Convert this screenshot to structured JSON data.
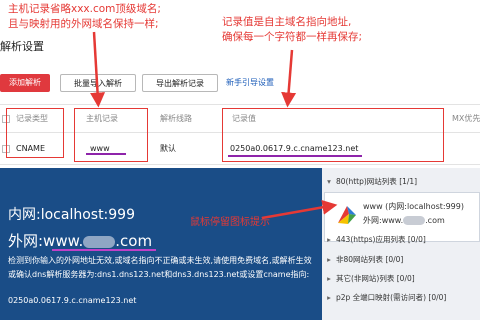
{
  "page": {
    "title": "解析设置"
  },
  "toolbar": {
    "add_label": "添加解析",
    "import_label": "批量导入解析",
    "export_label": "导出解析记录",
    "guide_label": "新手引导设置"
  },
  "table": {
    "headers": {
      "record_type": "记录类型",
      "host_record": "主机记录",
      "line": "解析线路",
      "record_value": "记录值",
      "mx": "MX优先"
    },
    "row": {
      "record_type": "CNAME",
      "host_record": "www",
      "line": "默认",
      "record_value": "0250a0.0617.9.c.cname123.net"
    }
  },
  "annotations": {
    "note_host_1": "主机记录省略xxx.com顶级域名;",
    "note_host_2": "且与映射用的外网域名保持一样;",
    "note_value_1": "记录值是自主域名指向地址,",
    "note_value_2": "确保每一个字符都一样再保存;",
    "hover_hint": "鼠标停留图标提示"
  },
  "overlay": {
    "inner": "内网:localhost:999",
    "outer_prefix": "外网:www.",
    "outer_suffix": ".com",
    "desc": "检测到你输入的外网地址无效,或域名指向不正确或未生效,请使用免费域名,或解析生效或确认dns解析服务器为:dns1.dns123.net和dns3.dns123.net或设置cname指向:",
    "cname": "0250a0.0617.9.c.cname123.net"
  },
  "sidebar": {
    "items": [
      {
        "label": "80(http)网站列表",
        "count": "[1/1]"
      },
      {
        "label": "443(https)应用列表",
        "count": "[0/0]"
      },
      {
        "label": "非80网站列表",
        "count": "[0/0]"
      },
      {
        "label": "其它(非网站)列表",
        "count": "[0/0]"
      },
      {
        "label": "p2p 全端口映射(需访问者)",
        "count": "[0/0]"
      }
    ],
    "card": {
      "line1": "www (内网:localhost:999)",
      "line2_prefix": "外网:www.",
      "line2_suffix": ".com"
    }
  },
  "colors": {
    "accent_red": "#e53935",
    "overlay_blue": "#1a4d87",
    "underline_purple": "#8e24aa",
    "link_blue": "#1a5bb8"
  }
}
